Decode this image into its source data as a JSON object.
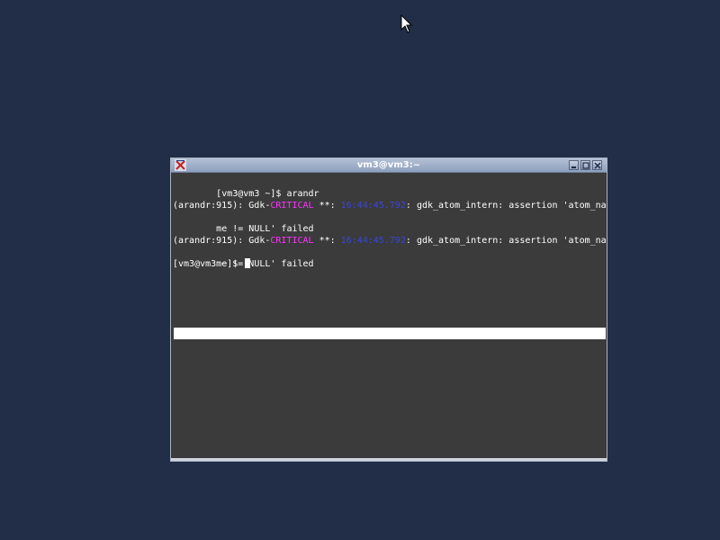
{
  "window": {
    "title": "vm3@vm3:~"
  },
  "terminal": {
    "line1": "[vm3@vm3 ~]$ arandr",
    "err1": {
      "prefix": "(arandr:915): Gdk-",
      "level": "CRITICAL",
      "sep": " **: ",
      "time": "16:44:45.792",
      "msg": ": gdk_atom_intern: assertion 'atom_na",
      "cont": "me != NULL' failed"
    },
    "err2": {
      "prefix": "(arandr:915): Gdk-",
      "level": "CRITICAL",
      "sep": " **: ",
      "time": "16:44:45.792",
      "msg": ": gdk_atom_intern: assertion 'atom_na",
      "cont": "me != NULL' failed"
    },
    "prompt": "[vm3@vm3 ~]$ "
  },
  "colors": {
    "desktop": "#222d47",
    "terminal_bg": "#3b3b3b",
    "critical": "#ff33ff",
    "timestamp": "#3a45d8"
  },
  "icons": {
    "app": "x-terminal-icon",
    "pointer": "mouse-pointer-icon"
  }
}
